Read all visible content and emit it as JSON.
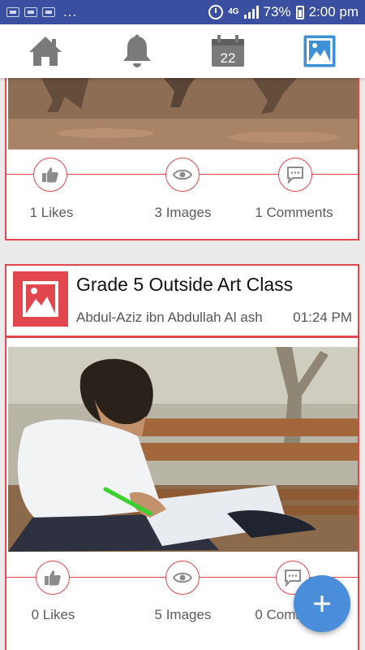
{
  "status_bar": {
    "network": "4G",
    "battery": "73%",
    "time": "2:00 pm",
    "overflow": "..."
  },
  "tabs": [
    {
      "icon": "home-icon",
      "active": false
    },
    {
      "icon": "bell-icon",
      "active": false
    },
    {
      "icon": "calendar-icon",
      "label": "22",
      "active": false
    },
    {
      "icon": "gallery-icon",
      "active": true
    }
  ],
  "colors": {
    "accent": "#e1474c",
    "active_tab": "#3d8fd6",
    "inactive_tab": "#7a7a7a",
    "fab": "#4a8ed9",
    "status_bar": "#3a4fa0"
  },
  "posts": [
    {
      "likes": "1 Likes",
      "images": "3 Images",
      "comments": "1 Comments"
    },
    {
      "title": "Grade 5 Outside Art Class",
      "author": "Abdul-Aziz ibn Abdullah Al ash",
      "time": "01:24 PM",
      "likes": "0 Likes",
      "images": "5 Images",
      "comments": "0 Comments"
    }
  ],
  "fab": {
    "icon": "plus-icon"
  }
}
